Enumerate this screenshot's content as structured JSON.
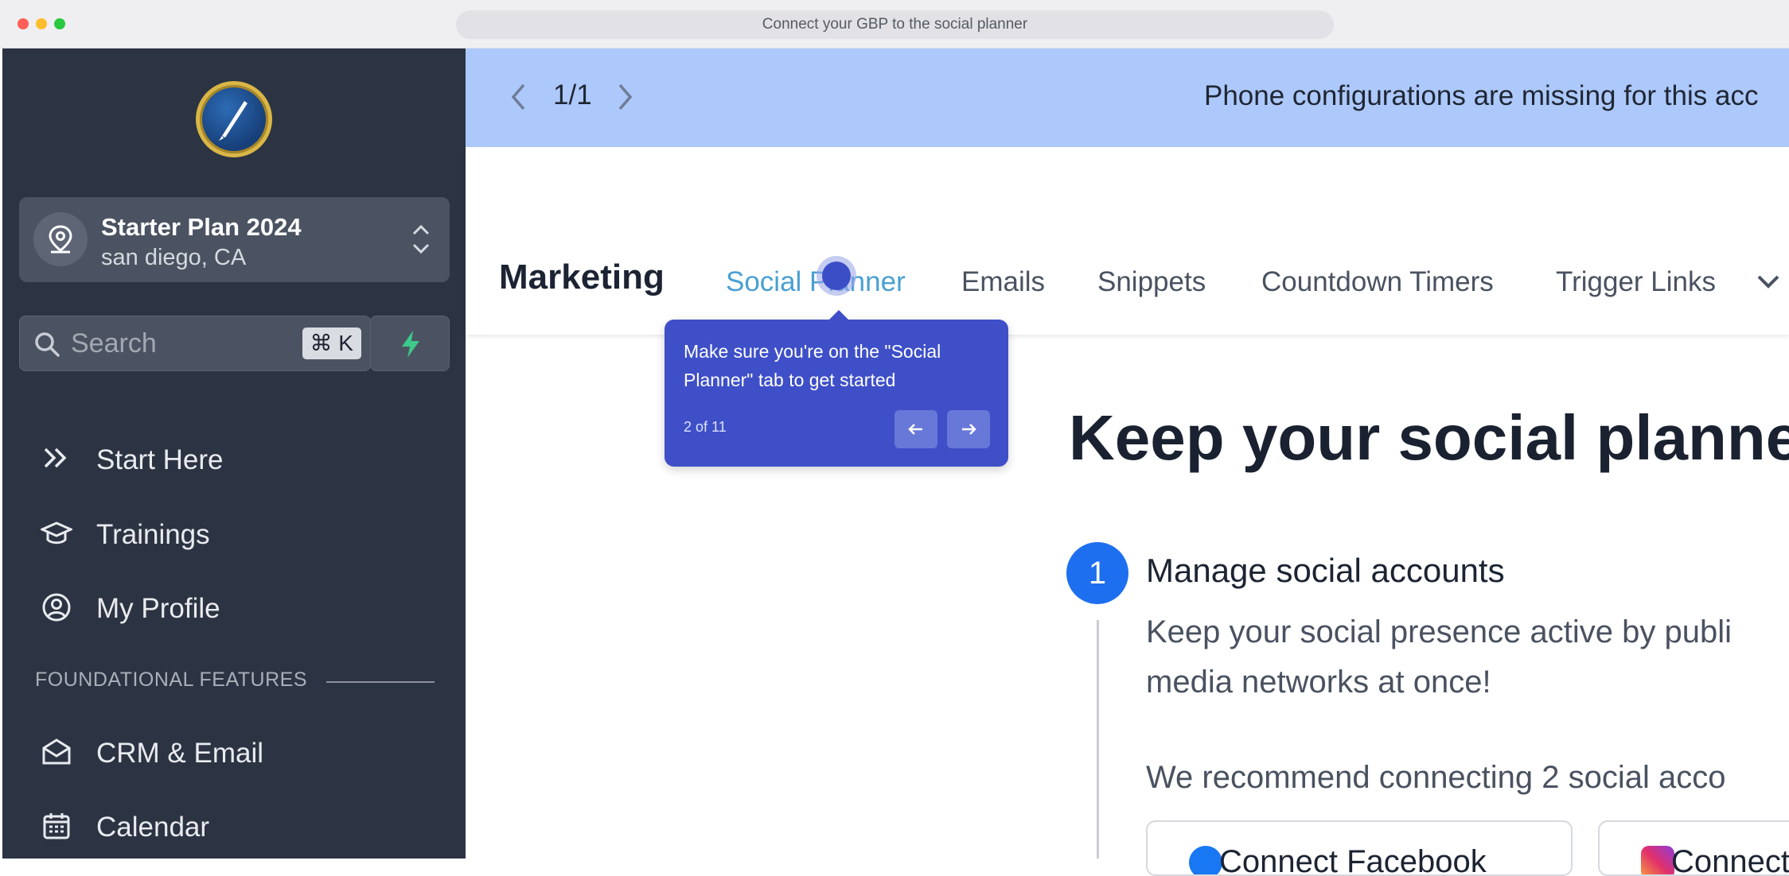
{
  "window": {
    "address_bar": "Connect your GBP to the social planner"
  },
  "sidebar": {
    "account": {
      "name": "Starter Plan 2024",
      "location": "san diego, CA"
    },
    "search": {
      "placeholder": "Search",
      "shortcut": "⌘ K"
    },
    "nav_top": [
      {
        "label": "Start Here",
        "icon": "double-chevron-icon"
      },
      {
        "label": "Trainings",
        "icon": "graduation-cap-icon"
      },
      {
        "label": "My Profile",
        "icon": "user-circle-icon"
      }
    ],
    "section_label": "FOUNDATIONAL FEATURES",
    "nav_bottom": [
      {
        "label": "CRM & Email",
        "icon": "envelope-icon"
      },
      {
        "label": "Calendar",
        "icon": "calendar-icon"
      }
    ]
  },
  "banner": {
    "counter": "1/1",
    "message": "Phone configurations are missing for this acc"
  },
  "tabs": {
    "title": "Marketing",
    "items": [
      "Social Planner",
      "Emails",
      "Snippets",
      "Countdown Timers",
      "Trigger Links"
    ],
    "active": "Social Planner"
  },
  "content": {
    "hero": "Keep your social planne",
    "step": {
      "number": "1",
      "title": "Manage social accounts",
      "desc_line1": "Keep your social presence active by publi",
      "desc_line2": "media networks at once!",
      "recommend": "We recommend connecting 2 social acco"
    },
    "connect_buttons": [
      {
        "label": "Connect Facebook",
        "icon": "facebook-icon"
      },
      {
        "label": "Connect Instagram",
        "icon": "instagram-icon"
      }
    ]
  },
  "tooltip": {
    "text": "Make sure you're on the \"Social Planner\" tab to get started",
    "count": "2 of 11"
  },
  "colors": {
    "sidebar_bg": "#2c3443",
    "banner_bg": "#adc9fb",
    "tooltip_bg": "#3e4fc8",
    "active_tab": "#4aa0d2",
    "step_badge": "#1d6ff0"
  }
}
